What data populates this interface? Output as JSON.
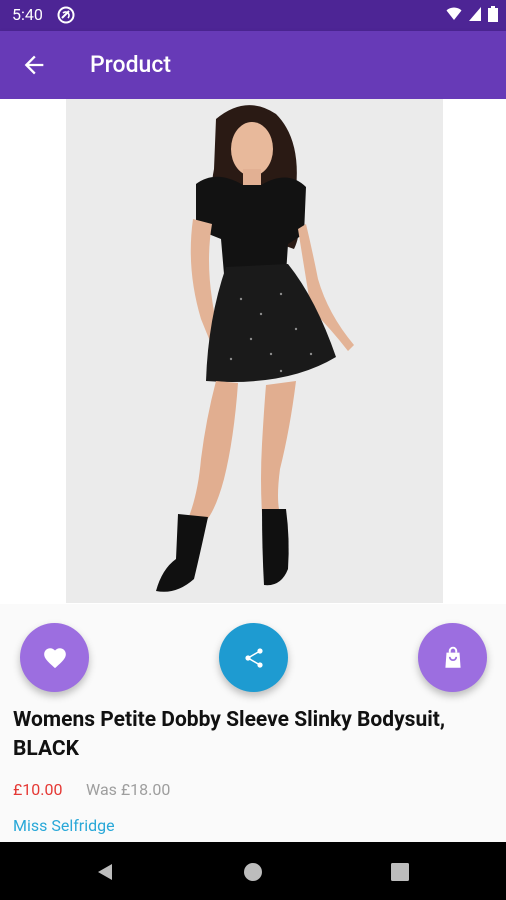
{
  "status_bar": {
    "time": "5:40"
  },
  "app_bar": {
    "title": "Product",
    "back_icon": "arrow-back-icon"
  },
  "product": {
    "name": "Womens Petite Dobby Sleeve Slinky Bodysuit, BLACK",
    "price": "£10.00",
    "was_price": "Was £18.00",
    "brand": "Miss Selfridge"
  },
  "actions": [
    {
      "name": "favorite",
      "icon": "heart-icon",
      "color": "#9c6ee0"
    },
    {
      "name": "share",
      "icon": "share-icon",
      "color": "#1e9bd1"
    },
    {
      "name": "add-to-bag",
      "icon": "shopping-bag-icon",
      "color": "#9c6ee0"
    }
  ],
  "colors": {
    "status_bar": "#4d2595",
    "app_bar": "#673ab7",
    "price": "#e53935",
    "was_price": "#9e9e9e",
    "brand": "#29a8d8",
    "fab_purple": "#9c6ee0",
    "fab_blue": "#1e9bd1"
  }
}
